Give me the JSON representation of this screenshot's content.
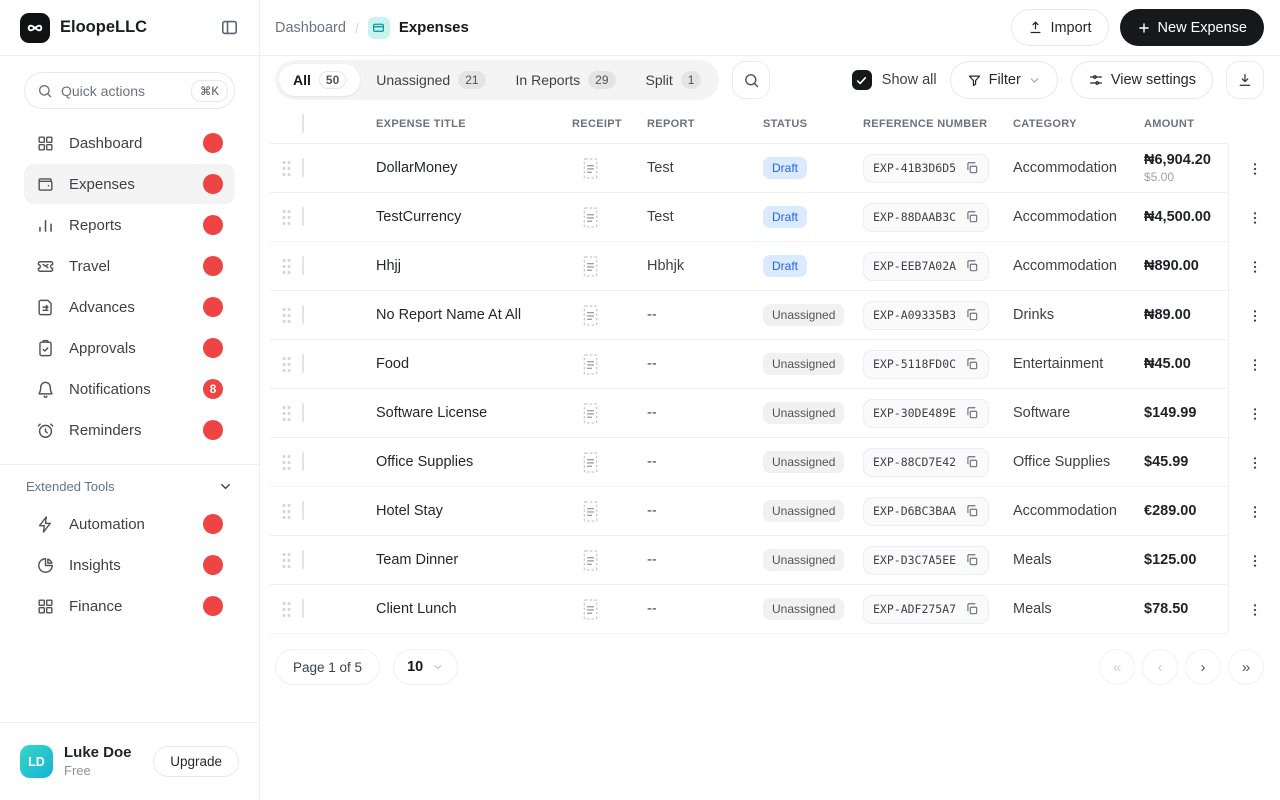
{
  "app": {
    "name": "EloopeLLC"
  },
  "sidebar": {
    "search": {
      "placeholder": "Quick actions",
      "shortcut": "⌘K"
    },
    "items": [
      {
        "label": "Dashboard",
        "icon": "dashboard-icon",
        "active": false
      },
      {
        "label": "Expenses",
        "icon": "wallet-icon",
        "active": true
      },
      {
        "label": "Reports",
        "icon": "bar-chart-icon",
        "active": false
      },
      {
        "label": "Travel",
        "icon": "ticket-icon",
        "active": false
      },
      {
        "label": "Advances",
        "icon": "document-icon",
        "active": false
      },
      {
        "label": "Approvals",
        "icon": "clipboard-check-icon",
        "active": false
      },
      {
        "label": "Notifications",
        "icon": "bell-icon",
        "active": false,
        "badge": "8"
      },
      {
        "label": "Reminders",
        "icon": "alarm-clock-icon",
        "active": false
      }
    ],
    "tools_label": "Extended Tools",
    "tools": [
      {
        "label": "Automation",
        "icon": "zap-icon"
      },
      {
        "label": "Insights",
        "icon": "pie-chart-icon"
      },
      {
        "label": "Finance",
        "icon": "grid-icon"
      }
    ],
    "user": {
      "initials": "LD",
      "name": "Luke Doe",
      "plan": "Free",
      "upgrade_label": "Upgrade"
    }
  },
  "header": {
    "breadcrumb_parent": "Dashboard",
    "breadcrumb_separator": "/",
    "breadcrumb_current": "Expenses",
    "import_label": "Import",
    "new_expense_label": "New Expense"
  },
  "toolbar": {
    "tabs": [
      {
        "label": "All",
        "count": "50",
        "active": true
      },
      {
        "label": "Unassigned",
        "count": "21",
        "active": false
      },
      {
        "label": "In Reports",
        "count": "29",
        "active": false
      },
      {
        "label": "Split",
        "count": "1",
        "active": false
      }
    ],
    "show_all_label": "Show all",
    "filter_label": "Filter",
    "view_settings_label": "View settings"
  },
  "table": {
    "columns": [
      "EXPENSE TITLE",
      "RECEIPT",
      "REPORT",
      "STATUS",
      "REFERENCE NUMBER",
      "CATEGORY",
      "AMOUNT"
    ],
    "rows": [
      {
        "title": "DollarMoney",
        "report": "Test",
        "status": "Draft",
        "reference": "EXP-41B3D6D5",
        "category": "Accommodation",
        "amount": "₦6,904.20",
        "amount_secondary": "$5.00"
      },
      {
        "title": "TestCurrency",
        "report": "Test",
        "status": "Draft",
        "reference": "EXP-88DAAB3C",
        "category": "Accommodation",
        "amount": "₦4,500.00"
      },
      {
        "title": "Hhjj",
        "report": "Hbhjk",
        "status": "Draft",
        "reference": "EXP-EEB7A02A",
        "category": "Accommodation",
        "amount": "₦890.00"
      },
      {
        "title": "No Report Name At All",
        "report": "--",
        "status": "Unassigned",
        "reference": "EXP-A09335B3",
        "category": "Drinks",
        "amount": "₦89.00"
      },
      {
        "title": "Food",
        "report": "--",
        "status": "Unassigned",
        "reference": "EXP-5118FD0C",
        "category": "Entertainment",
        "amount": "₦45.00"
      },
      {
        "title": "Software License",
        "report": "--",
        "status": "Unassigned",
        "reference": "EXP-30DE489E",
        "category": "Software",
        "amount": "$149.99"
      },
      {
        "title": "Office Supplies",
        "report": "--",
        "status": "Unassigned",
        "reference": "EXP-88CD7E42",
        "category": "Office Supplies",
        "amount": "$45.99"
      },
      {
        "title": "Hotel Stay",
        "report": "--",
        "status": "Unassigned",
        "reference": "EXP-D6BC3BAA",
        "category": "Accommodation",
        "amount": "€289.00"
      },
      {
        "title": "Team Dinner",
        "report": "--",
        "status": "Unassigned",
        "reference": "EXP-D3C7A5EE",
        "category": "Meals",
        "amount": "$125.00"
      },
      {
        "title": "Client Lunch",
        "report": "--",
        "status": "Unassigned",
        "reference": "EXP-ADF275A7",
        "category": "Meals",
        "amount": "$78.50"
      }
    ]
  },
  "pagination": {
    "page_label": "Page 1 of 5",
    "page_size": "10",
    "first_label": "«",
    "prev_label": "‹",
    "next_label": "›",
    "last_label": "»"
  },
  "colors": {
    "primary_button": "#17181b",
    "notification_badge": "#ef4444",
    "draft_badge_bg": "#dbeafe",
    "draft_badge_text": "#2563eb",
    "unassigned_badge_bg": "#f1f1f2",
    "unassigned_badge_text": "#52525b",
    "breadcrumb_chip_bg": "#c9f3f0",
    "breadcrumb_chip_icon": "#0d9ba8",
    "avatar_gradient": [
      "#38d6c4",
      "#15b3d6"
    ],
    "active_nav_bg": "#f4f4f5"
  }
}
